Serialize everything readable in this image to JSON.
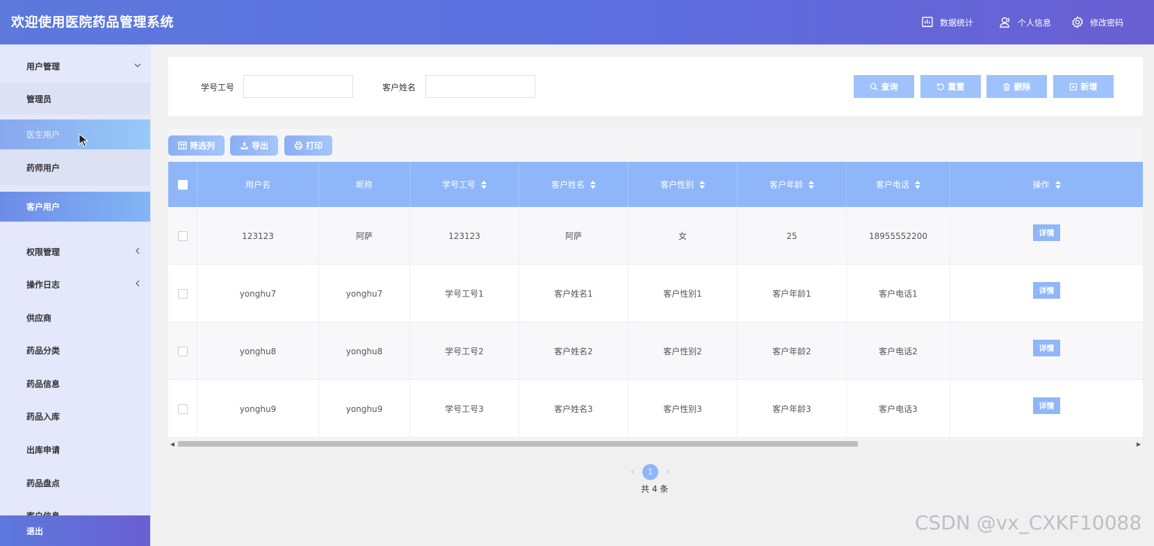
{
  "header": {
    "title": "欢迎使用医院药品管理系统",
    "nav": [
      {
        "label": "数据统计",
        "icon": "chart-icon"
      },
      {
        "label": "个人信息",
        "icon": "user-icon"
      },
      {
        "label": "修改密码",
        "icon": "gear-icon"
      }
    ]
  },
  "sidebar": {
    "items": [
      {
        "label": "用户管理",
        "state": "expanded"
      },
      {
        "label": "管理员",
        "state": "sub"
      },
      {
        "label": "医生用户",
        "state": "hover"
      },
      {
        "label": "药师用户",
        "state": "sub"
      },
      {
        "label": "客户用户",
        "state": "active"
      },
      {
        "label": "权限管理",
        "state": "collapsed"
      },
      {
        "label": "操作日志",
        "state": "collapsed"
      },
      {
        "label": "供应商"
      },
      {
        "label": "药品分类"
      },
      {
        "label": "药品信息"
      },
      {
        "label": "药品入库"
      },
      {
        "label": "出库申请"
      },
      {
        "label": "药品盘点"
      },
      {
        "label": "客户信息"
      }
    ],
    "logout": "退出"
  },
  "search": {
    "fields": [
      {
        "label": "学号工号",
        "value": "",
        "placeholder": ""
      },
      {
        "label": "客户姓名",
        "value": "",
        "placeholder": ""
      }
    ],
    "buttons": [
      {
        "label": "查询",
        "icon": "search-icon"
      },
      {
        "label": "重置",
        "icon": "refresh-icon"
      },
      {
        "label": "删除",
        "icon": "trash-icon"
      },
      {
        "label": "新增",
        "icon": "plus-icon"
      }
    ]
  },
  "toolbar": {
    "filter_columns": "筛选列",
    "export": "导出",
    "print": "打印"
  },
  "table": {
    "columns": [
      "用户名",
      "昵称",
      "学号工号",
      "客户姓名",
      "客户性别",
      "客户年龄",
      "客户电话",
      "操作"
    ],
    "rows": [
      [
        "123123",
        "阿萨",
        "123123",
        "阿萨",
        "女",
        "25",
        "18955552200"
      ],
      [
        "yonghu7",
        "yonghu7",
        "学号工号1",
        "客户姓名1",
        "客户性别1",
        "客户年龄1",
        "客户电话1"
      ],
      [
        "yonghu8",
        "yonghu8",
        "学号工号2",
        "客户姓名2",
        "客户性别2",
        "客户年龄2",
        "客户电话2"
      ],
      [
        "yonghu9",
        "yonghu9",
        "学号工号3",
        "客户姓名3",
        "客户性别3",
        "客户年龄3",
        "客户电话3"
      ]
    ],
    "action_label": "详情"
  },
  "pagination": {
    "current_page": "1",
    "total_text": "共 4 条"
  },
  "watermark": "CSDN @vx_CXKF10088",
  "colors": {
    "header_gradient_start": "#5d79dc",
    "header_gradient_end": "#6a5fd2",
    "table_header": "#8fb6f8",
    "sidebar_bg": "#e4e8fa",
    "button": "#9fc2fb"
  }
}
